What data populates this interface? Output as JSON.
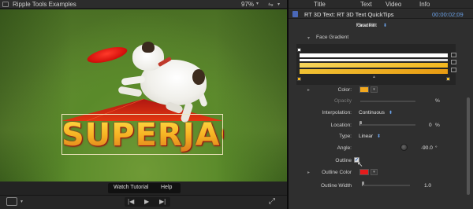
{
  "viewer": {
    "title": "Ripple Tools Examples",
    "zoom": "97%",
    "zoom_caret": "▾",
    "menu_icon": "switch-icon",
    "menu_glyph": "⇋",
    "caret_glyph": "▾",
    "title_overlay_text": "SUPERJACK",
    "help_bar": {
      "watch_tutorial": "Watch Tutorial",
      "help": "Help"
    },
    "transport": {
      "previous": "|◀",
      "play": "▶",
      "next": "▶|",
      "fullscreen": "⤢"
    }
  },
  "inspector": {
    "tabs": [
      "Title",
      "Text",
      "Video",
      "Info"
    ],
    "header_title": "RT 3D Text: RT 3D Text QuickTips",
    "timecode": "00:00:02;09",
    "face_fill": {
      "label": "Face Fill",
      "value": "Gradient",
      "glyph": "⬍"
    },
    "face_gradient": {
      "label": "Face Gradient",
      "glyph": "▾"
    },
    "color": {
      "label": "Color:",
      "swatch": "#f2a81f",
      "glyph": "▸"
    },
    "opacity": {
      "label": "Opacity",
      "unit": "%"
    },
    "interpolation": {
      "label": "Interpolation:",
      "value": "Continuous",
      "glyph": "⬍"
    },
    "location": {
      "label": "Location:",
      "value": "0",
      "unit": "%"
    },
    "type": {
      "label": "Type:",
      "value": "Linear",
      "glyph": "⬍"
    },
    "angle": {
      "label": "Angle:",
      "value": "-90.0",
      "unit": "°"
    },
    "outline": {
      "label": "Outline",
      "checked": true,
      "check_glyph": "✓",
      "cursor_glyph": "↖"
    },
    "outline_color": {
      "label": "Outline Color",
      "swatch": "#e41b1b",
      "glyph": "▸"
    },
    "outline_width": {
      "label": "Outline Width",
      "value": "1.0"
    },
    "swatch_caret": "▾",
    "accent": "#6aa0e6"
  }
}
